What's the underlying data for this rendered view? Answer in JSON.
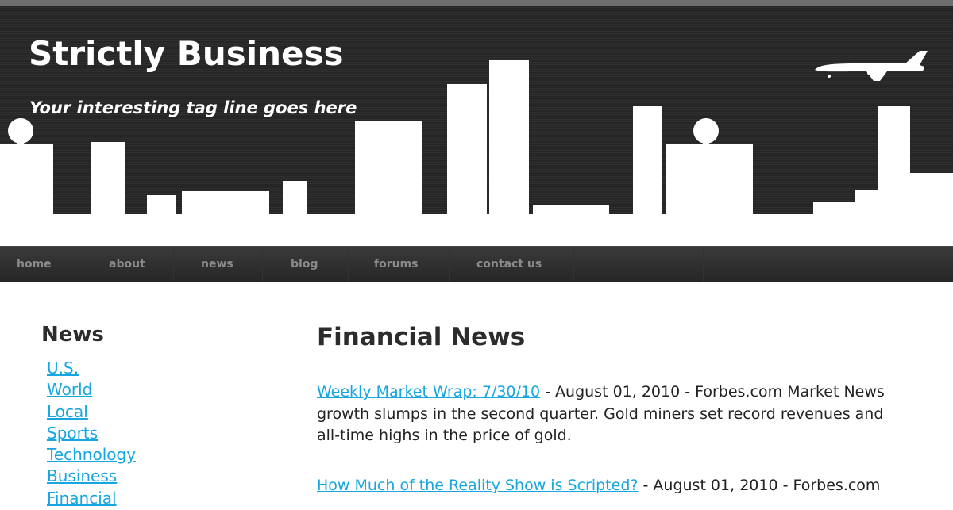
{
  "header": {
    "site_title": "Strictly Business",
    "tagline": "Your interesting tag line goes here"
  },
  "nav": {
    "items": [
      {
        "label": "home"
      },
      {
        "label": "about"
      },
      {
        "label": "news"
      },
      {
        "label": "blog"
      },
      {
        "label": "forums"
      },
      {
        "label": "contact us"
      }
    ]
  },
  "sidebar": {
    "title": "News",
    "links": [
      {
        "label": "U.S."
      },
      {
        "label": "World"
      },
      {
        "label": "Local"
      },
      {
        "label": "Sports"
      },
      {
        "label": "Technology"
      },
      {
        "label": "Business"
      },
      {
        "label": "Financial"
      }
    ]
  },
  "main": {
    "title": "Financial News",
    "articles": [
      {
        "title": "Weekly Market Wrap: 7/30/10",
        "rest_line1": " - August 01, 2010 - Forbes.com Market News",
        "line2": "growth slumps in the second quarter. Gold miners set record revenues and",
        "line3": "all-time highs in the price of gold."
      },
      {
        "title": "How Much of the Reality Show is Scripted?",
        "rest_line1": " - August 01, 2010 - Forbes.com"
      }
    ]
  },
  "colors": {
    "header_bg": "#262626",
    "link": "#17a6df",
    "nav_text": "#8a8a8a",
    "heading_text": "#2c2c2c"
  },
  "icons": {
    "skyline": "city-skyline-graphic",
    "plane": "airplane-icon"
  }
}
